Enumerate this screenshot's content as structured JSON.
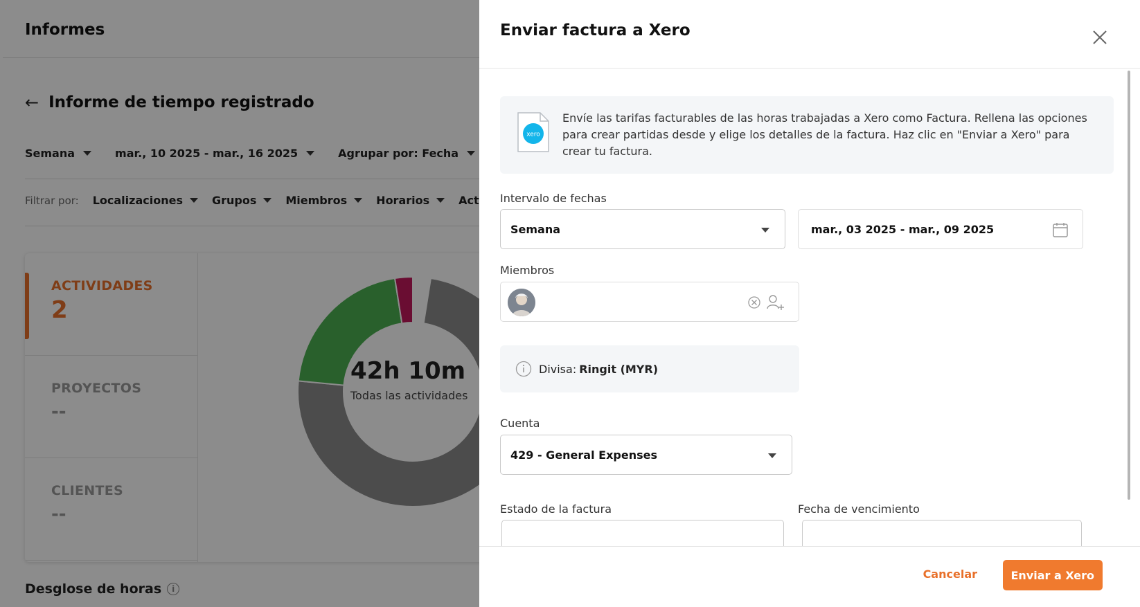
{
  "background": {
    "page_title": "Informes",
    "report_title": "Informe de tiempo registrado",
    "period": "Semana",
    "date_range": "mar., 10 2025 - mar., 16 2025",
    "group_by": "Agrupar por: Fecha",
    "filter_label": "Filtrar por:",
    "filters": [
      "Localizaciones",
      "Grupos",
      "Miembros",
      "Horarios",
      "Activ"
    ],
    "stats": [
      {
        "label": "ACTIVIDADES",
        "value": "2"
      },
      {
        "label": "PROYECTOS",
        "value": "--"
      },
      {
        "label": "CLIENTES",
        "value": "--"
      }
    ],
    "donut_total": "42h 10m",
    "donut_subtitle": "Todas las actividades",
    "breakdown_title": "Desglose de horas",
    "donut_segments": [
      {
        "value": 0.74,
        "color": "#8a8a8a"
      },
      {
        "value": 0.21,
        "color": "#4caf50"
      },
      {
        "value": 0.025,
        "color": "#c2185b"
      }
    ]
  },
  "drawer": {
    "title": "Enviar factura a Xero",
    "info_text": "Envíe las tarifas facturables de las horas trabajadas a Xero como Factura. Rellena las opciones para crear partidas desde y elige los detalles de la factura. Haz clic en \"Enviar a Xero\" para crear tu factura.",
    "xero_logo_text": "xero",
    "date_interval_label": "Intervalo de fechas",
    "date_interval_value": "Semana",
    "date_range_value": "mar., 03 2025 - mar., 09 2025",
    "members_label": "Miembros",
    "currency_label": "Divisa:",
    "currency_value": "Ringit (MYR)",
    "account_label": "Cuenta",
    "account_value": "429 - General Expenses",
    "invoice_status_label": "Estado de la factura",
    "due_date_label": "Fecha de vencimiento",
    "cancel_label": "Cancelar",
    "send_label": "Enviar a Xero"
  },
  "colors": {
    "accent": "#f07a2e",
    "xero_blue": "#13b5ea"
  }
}
